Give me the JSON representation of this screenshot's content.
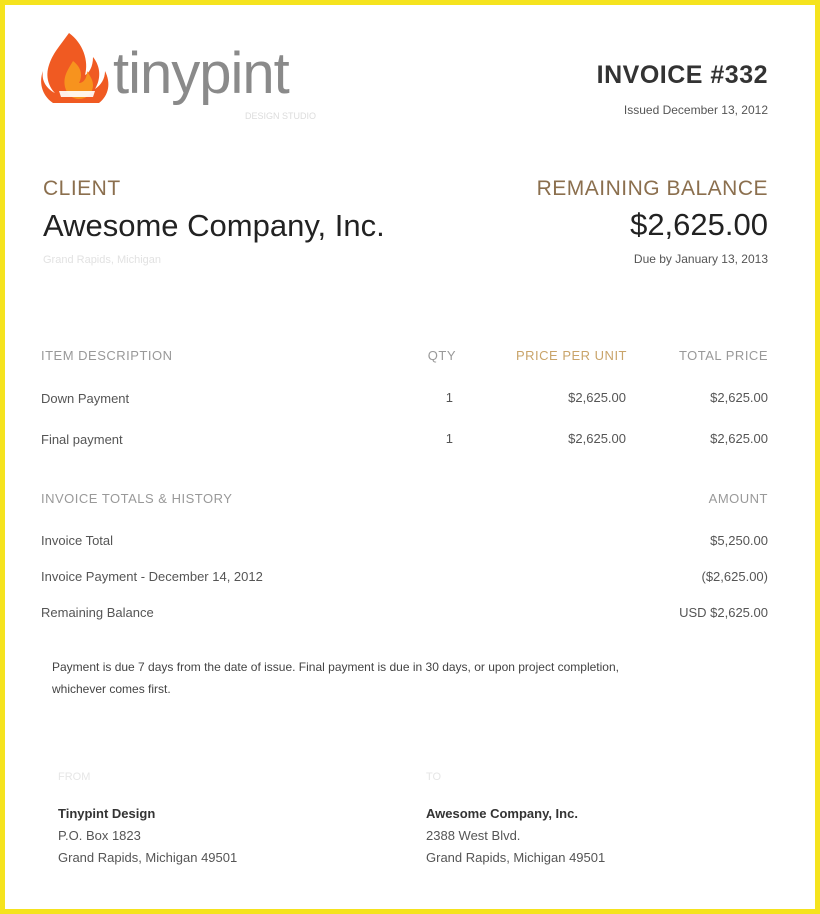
{
  "brand": {
    "name": "tinypint",
    "tagline": "DESIGN STUDIO",
    "flame_colors": {
      "outer": "#f05a22",
      "inner": "#f7931e"
    }
  },
  "invoice": {
    "title": "INVOICE #332",
    "issued": "Issued December 13, 2012"
  },
  "client": {
    "label": "CLIENT",
    "name": "Awesome Company, Inc.",
    "sub": "Grand Rapids, Michigan"
  },
  "balance": {
    "label": "REMAINING BALANCE",
    "amount": "$2,625.00",
    "due": "Due by January 13, 2013"
  },
  "items": {
    "headers": {
      "description": "ITEM DESCRIPTION",
      "qty": "QTY",
      "price": "PRICE PER UNIT",
      "total": "TOTAL PRICE"
    },
    "rows": [
      {
        "description": "Down Payment",
        "qty": "1",
        "price": "$2,625.00",
        "total": "$2,625.00"
      },
      {
        "description": "Final payment",
        "qty": "1",
        "price": "$2,625.00",
        "total": "$2,625.00"
      }
    ]
  },
  "history": {
    "headers": {
      "label": "INVOICE TOTALS & HISTORY",
      "amount": "AMOUNT"
    },
    "rows": [
      {
        "label": "Invoice Total",
        "amount": "$5,250.00"
      },
      {
        "label": "Invoice Payment - December 14, 2012",
        "amount": "($2,625.00)"
      },
      {
        "label": "Remaining Balance",
        "amount": "USD $2,625.00"
      }
    ]
  },
  "note": {
    "line1": "Payment is due 7 days from the date of issue. Final payment is due in 30 days, or upon project completion,",
    "line2": "whichever comes first."
  },
  "from": {
    "label": "FROM",
    "name": "Tinypint Design",
    "line1": "P.O. Box 1823",
    "line2": "Grand Rapids, Michigan 49501"
  },
  "to": {
    "label": "TO",
    "name": "Awesome Company, Inc.",
    "line1": "2388 West Blvd.",
    "line2": "Grand Rapids, Michigan 49501"
  }
}
